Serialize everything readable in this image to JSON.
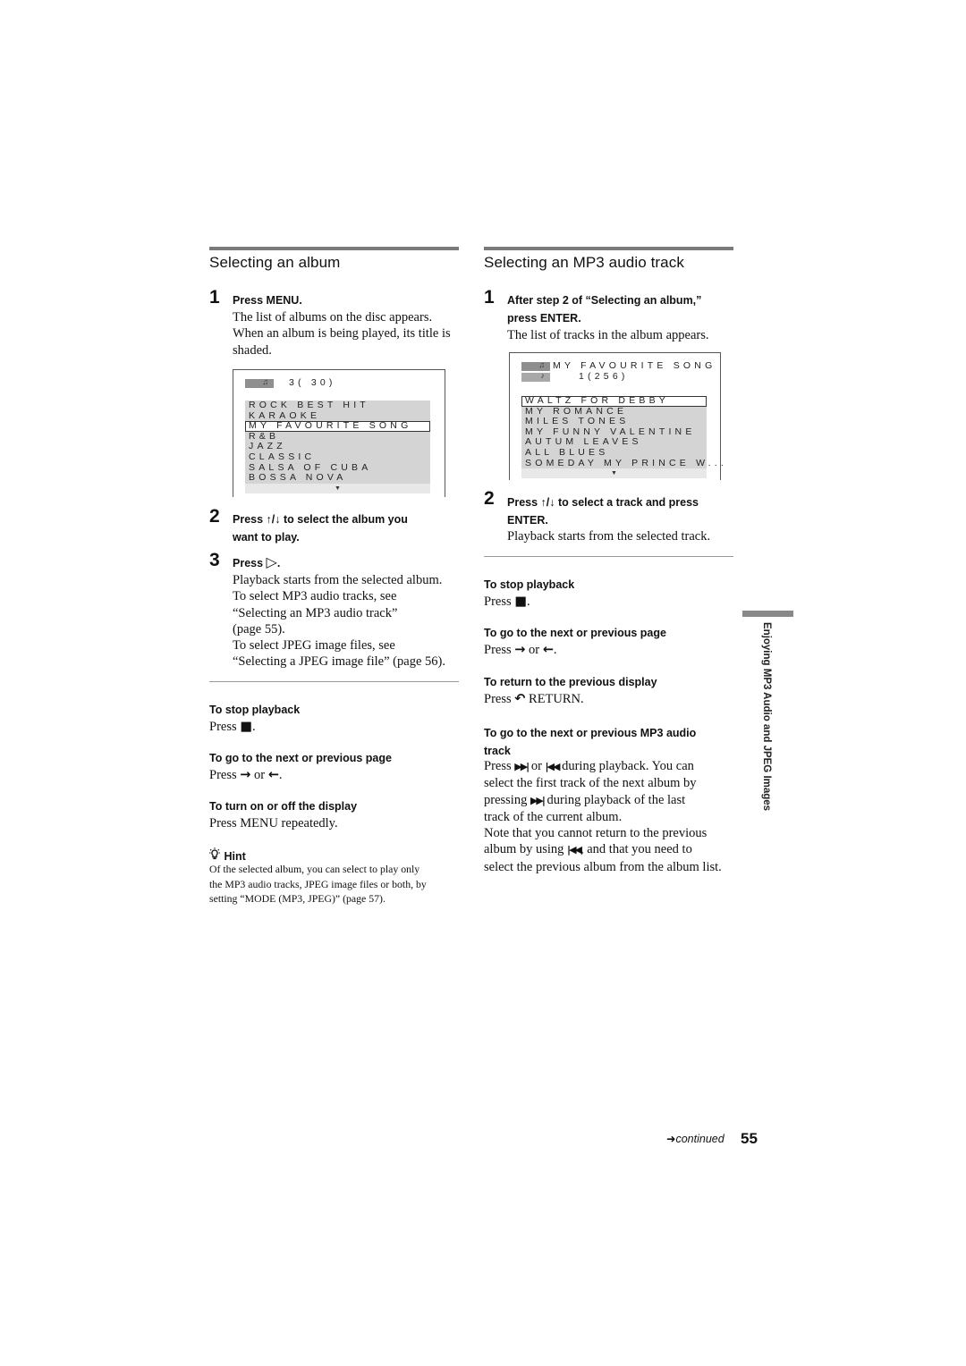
{
  "left": {
    "title": "Selecting an album",
    "steps": [
      {
        "num": "1",
        "head": "Press MENU.",
        "body": [
          "The list of albums on the disc appears.",
          "When an album is being played, its title is",
          "shaded."
        ]
      },
      {
        "num": "2",
        "head_line1": "Press ↑/↓ to select the album you",
        "head_line2": "want to play."
      },
      {
        "num": "3",
        "head_prefix": "Press",
        "head_icon": "play-icon",
        "head_glyph": "▷",
        "head_suffix": ".",
        "body": [
          "Playback starts from the selected album.",
          "To select MP3 audio tracks, see",
          "“Selecting an MP3 audio track”",
          "(page 55).",
          "To select JPEG image files, see",
          "“Selecting a JPEG image file” (page 56)."
        ]
      }
    ],
    "screen": {
      "counter": "3( 30)",
      "albums": [
        "ROCK BEST HIT",
        "KARAOKE",
        "MY FAVOURITE SONG",
        "R&B",
        "JAZZ",
        "CLASSIC",
        "SALSA OF CUBA",
        "BOSSA NOVA"
      ],
      "selected_index": 2,
      "more": "▼"
    },
    "tips": [
      {
        "head": "To stop playback",
        "body_prefix": "Press ",
        "glyph": "■",
        "body_suffix": "."
      },
      {
        "head": "To go to the next or previous page",
        "body_prefix": "Press ",
        "glyph": "→",
        "mid": " or ",
        "glyph2": "←",
        "body_suffix": "."
      },
      {
        "head": "To turn on or off the display",
        "body": "Press MENU repeatedly."
      }
    ],
    "hint": {
      "label": "Hint",
      "lines": [
        "Of the selected album, you can select to play only",
        "the MP3 audio tracks, JPEG image files or both, by",
        "setting “MODE (MP3, JPEG)” (page 57)."
      ]
    }
  },
  "right": {
    "title": "Selecting an MP3 audio track",
    "steps": [
      {
        "num": "1",
        "head_line1": "After step 2 of “Selecting an album,”",
        "head_line2": "press ENTER.",
        "body": [
          "The list of tracks in the album appears."
        ]
      },
      {
        "num": "2",
        "head_line1": "Press ↑/↓ to select a track and press",
        "head_line2": "ENTER.",
        "body": [
          "Playback starts from the selected track."
        ]
      }
    ],
    "screen": {
      "album_name": "MY FAVOURITE SONG",
      "counter": "1(256)",
      "tracks": [
        "WALTZ FOR DEBBY",
        "MY ROMANCE",
        "MILES TONES",
        "MY FUNNY VALENTINE",
        "AUTUM LEAVES",
        "ALL BLUES",
        "SOMEDAY MY PRINCE W..."
      ],
      "selected_index": 0,
      "more": "▼"
    },
    "tips": [
      {
        "head": "To stop playback",
        "body_prefix": "Press ",
        "glyph": "■",
        "body_suffix": "."
      },
      {
        "head": "To go to the next or previous page",
        "body_prefix": "Press ",
        "glyph": "→",
        "mid": " or ",
        "glyph2": "←",
        "body_suffix": "."
      },
      {
        "head": "To return to the previous display",
        "body_prefix": "Press ",
        "glyph": "↶",
        "body_suffix": " RETURN."
      },
      {
        "head_line1": "To go to the next or previous MP3 audio",
        "head_line2": "track",
        "lines": [
          [
            "Press ",
            "▶▶|",
            " or ",
            "|◀◀",
            " during playback. You can"
          ],
          [
            "select the first track of the next album by"
          ],
          [
            "pressing ",
            "▶▶|",
            " during playback of the last"
          ],
          [
            "track of the current album."
          ],
          [
            "Note that you cannot return to the previous"
          ],
          [
            "album by using ",
            "|◀◀",
            ", and that you need to"
          ],
          [
            "select the previous album from the album list."
          ]
        ]
      }
    ]
  },
  "side_tab": "Enjoying MP3 Audio and JPEG Images",
  "footer": {
    "continued_arrow": "➜",
    "continued": "continued",
    "page_number": "55"
  }
}
